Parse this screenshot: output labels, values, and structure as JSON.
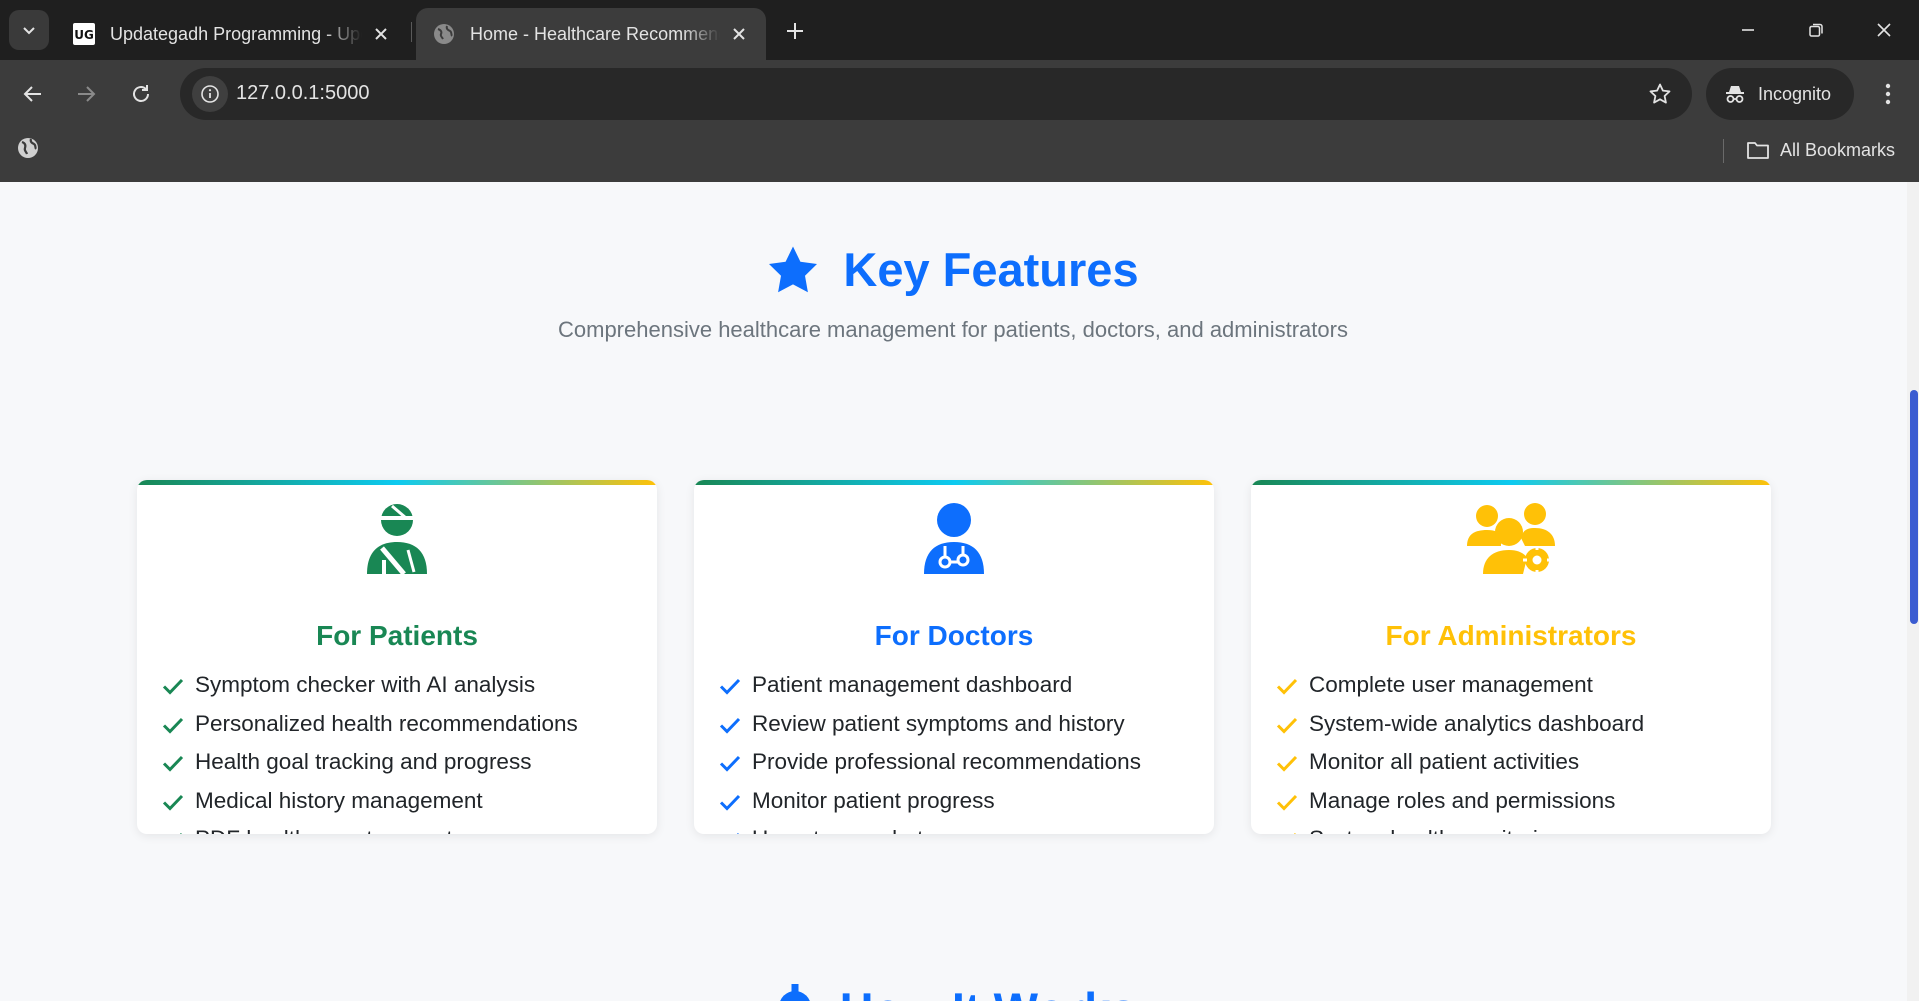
{
  "browser": {
    "tabs": [
      {
        "title": "Updategadh Programming - Updategadh",
        "active": false,
        "favicon_icon": "ug-logo-icon"
      },
      {
        "title": "Home - Healthcare Recommendation System",
        "active": true,
        "favicon_icon": "globe-icon"
      }
    ],
    "url": "127.0.0.1:5000",
    "profile_label": "Incognito",
    "bookmarks_label": "All Bookmarks"
  },
  "page": {
    "section_title": "Key Features",
    "section_subtitle": "Comprehensive healthcare management for patients, doctors, and administrators",
    "cards": [
      {
        "title": "For Patients",
        "accent": "#198754",
        "icon": "user-injured-icon",
        "features": [
          "Symptom checker with AI analysis",
          "Personalized health recommendations",
          "Health goal tracking and progress",
          "Medical history management",
          "PDF health reports export"
        ]
      },
      {
        "title": "For Doctors",
        "accent": "#0d6efd",
        "icon": "user-doctor-icon",
        "features": [
          "Patient management dashboard",
          "Review patient symptoms and history",
          "Provide professional recommendations",
          "Monitor patient progress",
          "Urgent case alerts"
        ]
      },
      {
        "title": "For Administrators",
        "accent": "#ffc107",
        "icon": "users-cog-icon",
        "features": [
          "Complete user management",
          "System-wide analytics dashboard",
          "Monitor all patient activities",
          "Manage roles and permissions",
          "System health monitoring"
        ]
      }
    ],
    "next_section_title": "How It Works"
  },
  "colors": {
    "primary": "#0d6efd",
    "success": "#198754",
    "warning": "#ffc107",
    "muted": "#6c757d"
  }
}
